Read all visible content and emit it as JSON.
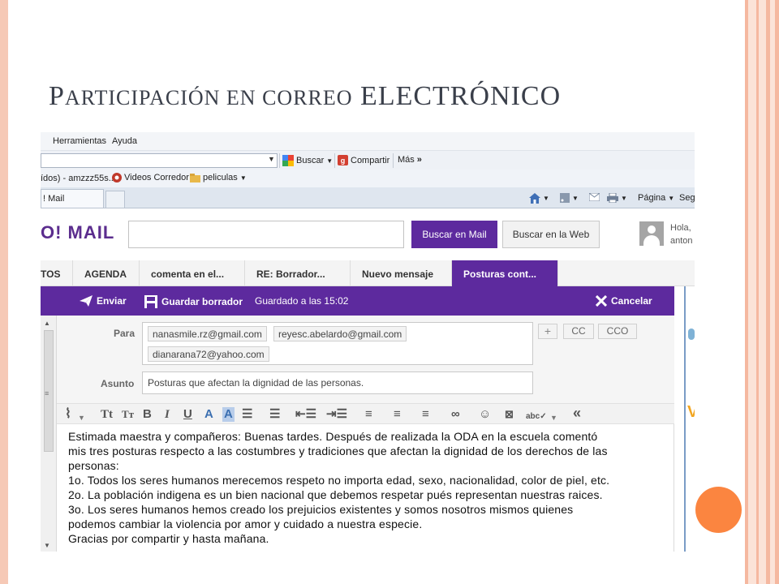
{
  "slide": {
    "title_first": "P",
    "title_small": "ARTICIPACIÓN EN CORREO",
    "title_last": "ELECTRÓNICO"
  },
  "colors": {
    "yahoo_purple": "#5d2a9e",
    "accent_orange": "#fb8540",
    "slide_stripe": "#f5b8a0"
  },
  "ie": {
    "menu": {
      "tools": "Herramientas",
      "help": "Ayuda"
    },
    "toolbar": {
      "search": "Buscar",
      "share": "Compartir",
      "more": "Más"
    },
    "favorites": {
      "item1": "ídos) - amzzz55s...",
      "item2": "Videos Corredor",
      "item3": "peliculas"
    },
    "tab_label": "! Mail",
    "commands": {
      "page": "Página",
      "safety": "Segu"
    }
  },
  "yahoo": {
    "logo": "O! MAIL",
    "search_mail_btn": "Buscar en Mail",
    "search_web_btn": "Buscar en la Web",
    "user": {
      "greeting": "Hola,",
      "name": "anton"
    },
    "tabs": [
      {
        "label": "TOS"
      },
      {
        "label": "AGENDA"
      },
      {
        "label": "comenta en el..."
      },
      {
        "label": "RE: Borrador..."
      },
      {
        "label": "Nuevo mensaje"
      },
      {
        "label": "Posturas cont..."
      }
    ],
    "compose": {
      "send": "Enviar",
      "save_draft": "Guardar borrador",
      "saved_status": "Guardado a las 15:02",
      "cancel": "Cancelar",
      "to_label": "Para",
      "recipients": [
        "nanasmile.rz@gmail.com",
        "reyesc.abelardo@gmail.com",
        "dianarana72@yahoo.com"
      ],
      "cc": "CC",
      "bcc": "CCO",
      "subject_label": "Asunto",
      "subject": "Posturas que afectan la dignidad de las personas.",
      "body_lines": [
        "Estimada maestra y compañeros: Buenas tardes. Después de realizada la ODA en la escuela comentó",
        "mis tres posturas respecto a las costumbres y tradiciones que afectan la dignidad de los derechos de las",
        "personas:",
        "1o. Todos los seres humanos merecemos respeto no importa edad, sexo, nacionalidad, color de piel, etc.",
        "2o. La población indigena es un bien nacional que debemos respetar pués representan nuestras raices.",
        "3o. Los seres humanos hemos creado los prejuicios existentes y somos nosotros mismos quienes",
        "podemos cambiar la violencia por amor y cuidado a nuestra especie.",
        "Gracias por compartir y hasta mañana."
      ]
    }
  }
}
